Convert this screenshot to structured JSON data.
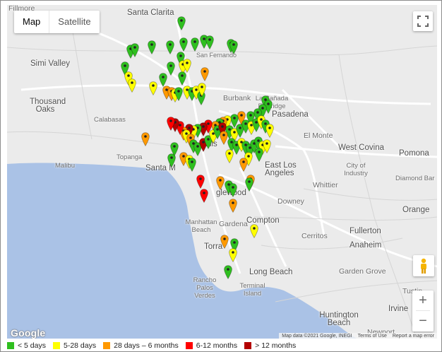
{
  "map_type": {
    "map": "Map",
    "satellite": "Satellite",
    "selected": "Map"
  },
  "controls": {
    "fullscreen": "fullscreen-icon",
    "pegman": "pegman-icon",
    "zoom_in": "+",
    "zoom_out": "−"
  },
  "places": [
    {
      "id": "fillmore",
      "label": "Fillmore"
    },
    {
      "id": "santa-clarita",
      "label": "Santa Clarita"
    },
    {
      "id": "simi-valley",
      "label": "Simi Valley"
    },
    {
      "id": "san-fernando",
      "label": "San Fernando"
    },
    {
      "id": "thousand-oaks",
      "label": "Thousand Oaks"
    },
    {
      "id": "burbank",
      "label": "Burbank"
    },
    {
      "id": "la-canada",
      "label": "La Cañada Flintridge"
    },
    {
      "id": "calabasas",
      "label": "Calabasas"
    },
    {
      "id": "pasadena",
      "label": "Pasadena"
    },
    {
      "id": "topanga",
      "label": "Topanga"
    },
    {
      "id": "malibu",
      "label": "Malibu"
    },
    {
      "id": "hills",
      "label": "Hills"
    },
    {
      "id": "santa-monica",
      "label": "Santa M"
    },
    {
      "id": "el-monte",
      "label": "El Monte"
    },
    {
      "id": "west-covina",
      "label": "West Covina"
    },
    {
      "id": "pomona",
      "label": "Pomona"
    },
    {
      "id": "east-la",
      "label": "East Los Angeles"
    },
    {
      "id": "industry",
      "label": "City of Industry"
    },
    {
      "id": "diamond-bar",
      "label": "Diamond Bar"
    },
    {
      "id": "whittier",
      "label": "Whittier"
    },
    {
      "id": "inglewood",
      "label": "glewood"
    },
    {
      "id": "downey",
      "label": "Downey"
    },
    {
      "id": "manhattan-beach",
      "label": "Manhattan Beach"
    },
    {
      "id": "gardena",
      "label": "Gardena"
    },
    {
      "id": "compton",
      "label": "Compton"
    },
    {
      "id": "fullerton",
      "label": "Fullerton"
    },
    {
      "id": "cerritos",
      "label": "Cerritos"
    },
    {
      "id": "anaheim",
      "label": "Anaheim"
    },
    {
      "id": "torrance",
      "label": "Torra"
    },
    {
      "id": "long-beach",
      "label": "Long Beach"
    },
    {
      "id": "garden-grove",
      "label": "Garden Grove"
    },
    {
      "id": "rancho-pv",
      "label": "Rancho Palos Verdes"
    },
    {
      "id": "terminal-island",
      "label": "Terminal Island"
    },
    {
      "id": "orange",
      "label": "Orange"
    },
    {
      "id": "tustin",
      "label": "Tustin"
    },
    {
      "id": "irvine",
      "label": "Irvine"
    },
    {
      "id": "huntington-beach",
      "label": "Huntington Beach"
    },
    {
      "id": "newport",
      "label": "Newport"
    }
  ],
  "google_logo": "Google",
  "attribution": {
    "data": "Map data ©2021 Google, INEGI",
    "terms": "Terms of Use",
    "report": "Report a map error"
  },
  "legend": [
    {
      "label": "< 5 days",
      "color": "#2fbf1f"
    },
    {
      "label": "5-28 days",
      "color": "#ffff00"
    },
    {
      "label": "28 days – 6 months",
      "color": "#ff9900"
    },
    {
      "label": "6-12 months",
      "color": "#ff0000"
    },
    {
      "label": "> 12 months",
      "color": "#b30000"
    }
  ]
}
